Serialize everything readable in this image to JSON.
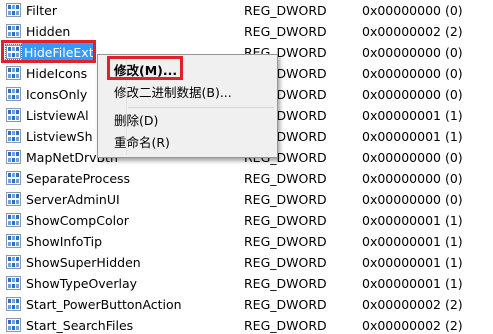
{
  "rows": [
    {
      "name": "Filter",
      "type": "REG_DWORD",
      "data": "0x00000000 (0)"
    },
    {
      "name": "Hidden",
      "type": "REG_DWORD",
      "data": "0x00000002 (2)"
    },
    {
      "name": "HideFileExt",
      "type": "REG_DWORD",
      "data": "0x00000000 (0)"
    },
    {
      "name": "HideIcons",
      "type": "REG_DWORD",
      "data": "0x00000000 (0)"
    },
    {
      "name": "IconsOnly",
      "type": "REG_DWORD",
      "data": "0x00000000 (0)"
    },
    {
      "name": "ListviewAl",
      "type": "REG_DWORD",
      "data": "0x00000001 (1)"
    },
    {
      "name": "ListviewSh",
      "type": "REG_DWORD",
      "data": "0x00000001 (1)"
    },
    {
      "name": "MapNetDrvBtn",
      "type": "REG_DWORD",
      "data": "0x00000000 (0)"
    },
    {
      "name": "SeparateProcess",
      "type": "REG_DWORD",
      "data": "0x00000000 (0)"
    },
    {
      "name": "ServerAdminUI",
      "type": "REG_DWORD",
      "data": "0x00000000 (0)"
    },
    {
      "name": "ShowCompColor",
      "type": "REG_DWORD",
      "data": "0x00000001 (1)"
    },
    {
      "name": "ShowInfoTip",
      "type": "REG_DWORD",
      "data": "0x00000001 (1)"
    },
    {
      "name": "ShowSuperHidden",
      "type": "REG_DWORD",
      "data": "0x00000001 (1)"
    },
    {
      "name": "ShowTypeOverlay",
      "type": "REG_DWORD",
      "data": "0x00000001 (1)"
    },
    {
      "name": "Start_PowerButtonAction",
      "type": "REG_DWORD",
      "data": "0x00000002 (2)"
    },
    {
      "name": "Start_SearchFiles",
      "type": "REG_DWORD",
      "data": "0x00000002 (2)"
    }
  ],
  "selected_index": 2,
  "context_menu": {
    "modify": "修改(M)...",
    "modify_binary": "修改二进制数据(B)...",
    "delete": "删除(D)",
    "rename": "重命名(R)"
  },
  "colors": {
    "selection": "#3399ff",
    "annotation_red": "#e0212b",
    "icon_blue": "#2a6fc9"
  },
  "icon": "registry-dword-icon"
}
